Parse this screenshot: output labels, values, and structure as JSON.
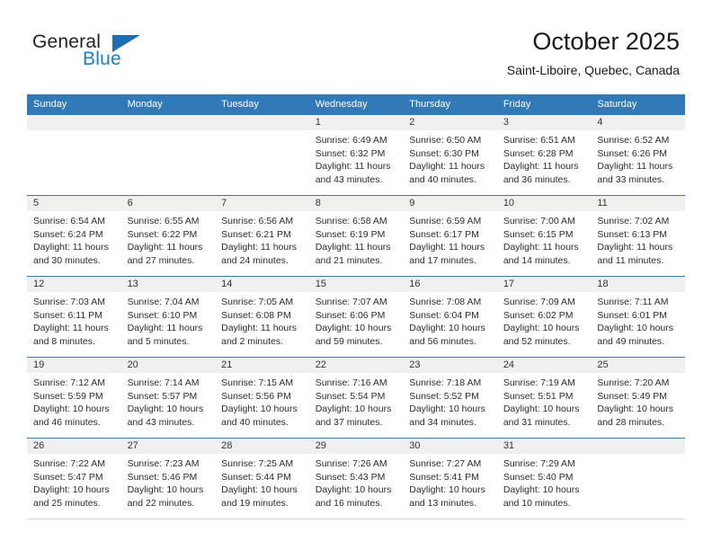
{
  "brand": {
    "name_part1": "General",
    "name_part2": "Blue",
    "accent_color": "#1c7fc4"
  },
  "header": {
    "title": "October 2025",
    "subtitle": "Saint-Liboire, Quebec, Canada",
    "header_bg_color": "#3279b8"
  },
  "weekdays": [
    "Sunday",
    "Monday",
    "Tuesday",
    "Wednesday",
    "Thursday",
    "Friday",
    "Saturday"
  ],
  "weeks": [
    [
      {
        "day": "",
        "sunrise": "",
        "sunset": "",
        "daylight_line1": "",
        "daylight_line2": ""
      },
      {
        "day": "",
        "sunrise": "",
        "sunset": "",
        "daylight_line1": "",
        "daylight_line2": ""
      },
      {
        "day": "",
        "sunrise": "",
        "sunset": "",
        "daylight_line1": "",
        "daylight_line2": ""
      },
      {
        "day": "1",
        "sunrise": "Sunrise: 6:49 AM",
        "sunset": "Sunset: 6:32 PM",
        "daylight_line1": "Daylight: 11 hours",
        "daylight_line2": "and 43 minutes."
      },
      {
        "day": "2",
        "sunrise": "Sunrise: 6:50 AM",
        "sunset": "Sunset: 6:30 PM",
        "daylight_line1": "Daylight: 11 hours",
        "daylight_line2": "and 40 minutes."
      },
      {
        "day": "3",
        "sunrise": "Sunrise: 6:51 AM",
        "sunset": "Sunset: 6:28 PM",
        "daylight_line1": "Daylight: 11 hours",
        "daylight_line2": "and 36 minutes."
      },
      {
        "day": "4",
        "sunrise": "Sunrise: 6:52 AM",
        "sunset": "Sunset: 6:26 PM",
        "daylight_line1": "Daylight: 11 hours",
        "daylight_line2": "and 33 minutes."
      }
    ],
    [
      {
        "day": "5",
        "sunrise": "Sunrise: 6:54 AM",
        "sunset": "Sunset: 6:24 PM",
        "daylight_line1": "Daylight: 11 hours",
        "daylight_line2": "and 30 minutes."
      },
      {
        "day": "6",
        "sunrise": "Sunrise: 6:55 AM",
        "sunset": "Sunset: 6:22 PM",
        "daylight_line1": "Daylight: 11 hours",
        "daylight_line2": "and 27 minutes."
      },
      {
        "day": "7",
        "sunrise": "Sunrise: 6:56 AM",
        "sunset": "Sunset: 6:21 PM",
        "daylight_line1": "Daylight: 11 hours",
        "daylight_line2": "and 24 minutes."
      },
      {
        "day": "8",
        "sunrise": "Sunrise: 6:58 AM",
        "sunset": "Sunset: 6:19 PM",
        "daylight_line1": "Daylight: 11 hours",
        "daylight_line2": "and 21 minutes."
      },
      {
        "day": "9",
        "sunrise": "Sunrise: 6:59 AM",
        "sunset": "Sunset: 6:17 PM",
        "daylight_line1": "Daylight: 11 hours",
        "daylight_line2": "and 17 minutes."
      },
      {
        "day": "10",
        "sunrise": "Sunrise: 7:00 AM",
        "sunset": "Sunset: 6:15 PM",
        "daylight_line1": "Daylight: 11 hours",
        "daylight_line2": "and 14 minutes."
      },
      {
        "day": "11",
        "sunrise": "Sunrise: 7:02 AM",
        "sunset": "Sunset: 6:13 PM",
        "daylight_line1": "Daylight: 11 hours",
        "daylight_line2": "and 11 minutes."
      }
    ],
    [
      {
        "day": "12",
        "sunrise": "Sunrise: 7:03 AM",
        "sunset": "Sunset: 6:11 PM",
        "daylight_line1": "Daylight: 11 hours",
        "daylight_line2": "and 8 minutes."
      },
      {
        "day": "13",
        "sunrise": "Sunrise: 7:04 AM",
        "sunset": "Sunset: 6:10 PM",
        "daylight_line1": "Daylight: 11 hours",
        "daylight_line2": "and 5 minutes."
      },
      {
        "day": "14",
        "sunrise": "Sunrise: 7:05 AM",
        "sunset": "Sunset: 6:08 PM",
        "daylight_line1": "Daylight: 11 hours",
        "daylight_line2": "and 2 minutes."
      },
      {
        "day": "15",
        "sunrise": "Sunrise: 7:07 AM",
        "sunset": "Sunset: 6:06 PM",
        "daylight_line1": "Daylight: 10 hours",
        "daylight_line2": "and 59 minutes."
      },
      {
        "day": "16",
        "sunrise": "Sunrise: 7:08 AM",
        "sunset": "Sunset: 6:04 PM",
        "daylight_line1": "Daylight: 10 hours",
        "daylight_line2": "and 56 minutes."
      },
      {
        "day": "17",
        "sunrise": "Sunrise: 7:09 AM",
        "sunset": "Sunset: 6:02 PM",
        "daylight_line1": "Daylight: 10 hours",
        "daylight_line2": "and 52 minutes."
      },
      {
        "day": "18",
        "sunrise": "Sunrise: 7:11 AM",
        "sunset": "Sunset: 6:01 PM",
        "daylight_line1": "Daylight: 10 hours",
        "daylight_line2": "and 49 minutes."
      }
    ],
    [
      {
        "day": "19",
        "sunrise": "Sunrise: 7:12 AM",
        "sunset": "Sunset: 5:59 PM",
        "daylight_line1": "Daylight: 10 hours",
        "daylight_line2": "and 46 minutes."
      },
      {
        "day": "20",
        "sunrise": "Sunrise: 7:14 AM",
        "sunset": "Sunset: 5:57 PM",
        "daylight_line1": "Daylight: 10 hours",
        "daylight_line2": "and 43 minutes."
      },
      {
        "day": "21",
        "sunrise": "Sunrise: 7:15 AM",
        "sunset": "Sunset: 5:56 PM",
        "daylight_line1": "Daylight: 10 hours",
        "daylight_line2": "and 40 minutes."
      },
      {
        "day": "22",
        "sunrise": "Sunrise: 7:16 AM",
        "sunset": "Sunset: 5:54 PM",
        "daylight_line1": "Daylight: 10 hours",
        "daylight_line2": "and 37 minutes."
      },
      {
        "day": "23",
        "sunrise": "Sunrise: 7:18 AM",
        "sunset": "Sunset: 5:52 PM",
        "daylight_line1": "Daylight: 10 hours",
        "daylight_line2": "and 34 minutes."
      },
      {
        "day": "24",
        "sunrise": "Sunrise: 7:19 AM",
        "sunset": "Sunset: 5:51 PM",
        "daylight_line1": "Daylight: 10 hours",
        "daylight_line2": "and 31 minutes."
      },
      {
        "day": "25",
        "sunrise": "Sunrise: 7:20 AM",
        "sunset": "Sunset: 5:49 PM",
        "daylight_line1": "Daylight: 10 hours",
        "daylight_line2": "and 28 minutes."
      }
    ],
    [
      {
        "day": "26",
        "sunrise": "Sunrise: 7:22 AM",
        "sunset": "Sunset: 5:47 PM",
        "daylight_line1": "Daylight: 10 hours",
        "daylight_line2": "and 25 minutes."
      },
      {
        "day": "27",
        "sunrise": "Sunrise: 7:23 AM",
        "sunset": "Sunset: 5:46 PM",
        "daylight_line1": "Daylight: 10 hours",
        "daylight_line2": "and 22 minutes."
      },
      {
        "day": "28",
        "sunrise": "Sunrise: 7:25 AM",
        "sunset": "Sunset: 5:44 PM",
        "daylight_line1": "Daylight: 10 hours",
        "daylight_line2": "and 19 minutes."
      },
      {
        "day": "29",
        "sunrise": "Sunrise: 7:26 AM",
        "sunset": "Sunset: 5:43 PM",
        "daylight_line1": "Daylight: 10 hours",
        "daylight_line2": "and 16 minutes."
      },
      {
        "day": "30",
        "sunrise": "Sunrise: 7:27 AM",
        "sunset": "Sunset: 5:41 PM",
        "daylight_line1": "Daylight: 10 hours",
        "daylight_line2": "and 13 minutes."
      },
      {
        "day": "31",
        "sunrise": "Sunrise: 7:29 AM",
        "sunset": "Sunset: 5:40 PM",
        "daylight_line1": "Daylight: 10 hours",
        "daylight_line2": "and 10 minutes."
      },
      {
        "day": "",
        "sunrise": "",
        "sunset": "",
        "daylight_line1": "",
        "daylight_line2": ""
      }
    ]
  ]
}
